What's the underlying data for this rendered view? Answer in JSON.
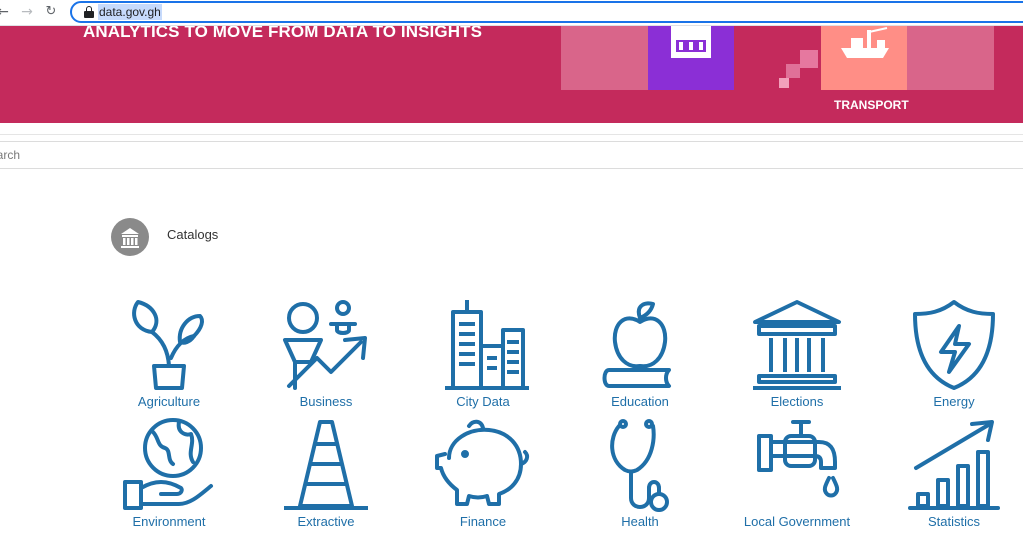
{
  "browser": {
    "url": "data.gov.gh",
    "icons": [
      "back-arrow-icon",
      "forward-arrow-icon",
      "reload-icon",
      "lock-icon"
    ]
  },
  "hero": {
    "headline": "ANALYTICS TO MOVE FROM DATA TO INSIGHTS",
    "tile_caption": "TRANSPORT",
    "colors": {
      "banner": "#c42a5c",
      "purple_tile": "#8b2fd6",
      "salmon_tile": "#ff8e86",
      "light_tile": "#d9658a"
    }
  },
  "search": {
    "placeholder": "earch"
  },
  "catalogs": {
    "label": "Catalogs",
    "icon": "bank-building-icon"
  },
  "categories": [
    {
      "label": "Agriculture",
      "icon": "plant-pot-icon"
    },
    {
      "label": "Business",
      "icon": "business-growth-icon"
    },
    {
      "label": "City Data",
      "icon": "city-buildings-icon"
    },
    {
      "label": "Education",
      "icon": "apple-book-icon"
    },
    {
      "label": "Elections",
      "icon": "government-building-icon"
    },
    {
      "label": "Energy",
      "icon": "shield-bolt-icon"
    },
    {
      "label": "Environment",
      "icon": "globe-hand-icon"
    },
    {
      "label": "Extractive",
      "icon": "traffic-cone-icon"
    },
    {
      "label": "Finance",
      "icon": "piggy-bank-icon"
    },
    {
      "label": "Health",
      "icon": "stethoscope-icon"
    },
    {
      "label": "Local Government",
      "icon": "water-tap-icon"
    },
    {
      "label": "Statistics",
      "icon": "bar-chart-growth-icon"
    }
  ],
  "accent_color": "#1f6fa8"
}
